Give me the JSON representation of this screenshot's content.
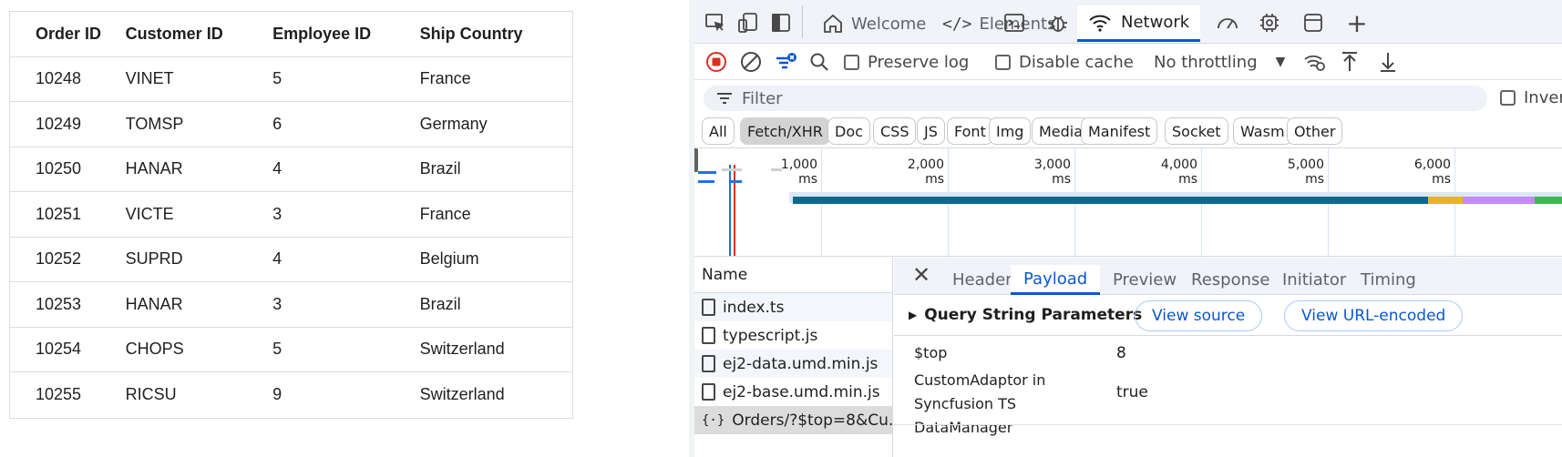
{
  "grid": {
    "columns": [
      "Order ID",
      "Customer ID",
      "Employee ID",
      "Ship Country"
    ],
    "rows": [
      [
        "10248",
        "VINET",
        "5",
        "France"
      ],
      [
        "10249",
        "TOMSP",
        "6",
        "Germany"
      ],
      [
        "10250",
        "HANAR",
        "4",
        "Brazil"
      ],
      [
        "10251",
        "VICTE",
        "3",
        "France"
      ],
      [
        "10252",
        "SUPRD",
        "4",
        "Belgium"
      ],
      [
        "10253",
        "HANAR",
        "3",
        "Brazil"
      ],
      [
        "10254",
        "CHOPS",
        "5",
        "Switzerland"
      ],
      [
        "10255",
        "RICSU",
        "9",
        "Switzerland"
      ]
    ]
  },
  "devtools": {
    "tabs": {
      "welcome": "Welcome",
      "elements": "Elements",
      "network": "Network"
    },
    "toolbar": {
      "preserve_log": "Preserve log",
      "disable_cache": "Disable cache",
      "throttling": "No throttling"
    },
    "filter": {
      "placeholder": "Filter",
      "invert": "Inver"
    },
    "types": [
      "All",
      "Fetch/XHR",
      "Doc",
      "CSS",
      "JS",
      "Font",
      "Img",
      "Media",
      "Manifest",
      "Socket",
      "Wasm",
      "Other"
    ],
    "active_type": "Fetch/XHR",
    "timeline_ticks": [
      "1,000 ms",
      "2,000 ms",
      "3,000 ms",
      "4,000 ms",
      "5,000 ms",
      "6,000 ms"
    ],
    "name_header": "Name",
    "files": [
      "index.ts",
      "typescript.js",
      "ej2-data.umd.min.js",
      "ej2-base.umd.min.js",
      "Orders/?$top=8&Cu..."
    ],
    "detail_tabs": [
      "Headers",
      "Payload",
      "Preview",
      "Response",
      "Initiator",
      "Timing"
    ],
    "active_detail_tab": "Payload",
    "query_title": "Query String Parameters",
    "view_source": "View source",
    "view_url_encoded": "View URL-encoded",
    "params": [
      {
        "name": "$top",
        "value": "8"
      },
      {
        "name": "CustomAdaptor in Syncfusion TS DataManager",
        "value": "true"
      }
    ],
    "colors": {
      "accent": "#0b57d0",
      "record": "#d93025",
      "waterfall_bar": "#0e6a8c",
      "waterfall_wait": "#e8b423",
      "waterfall_download": "#c58af9",
      "waterfall_done": "#3fb950"
    }
  }
}
